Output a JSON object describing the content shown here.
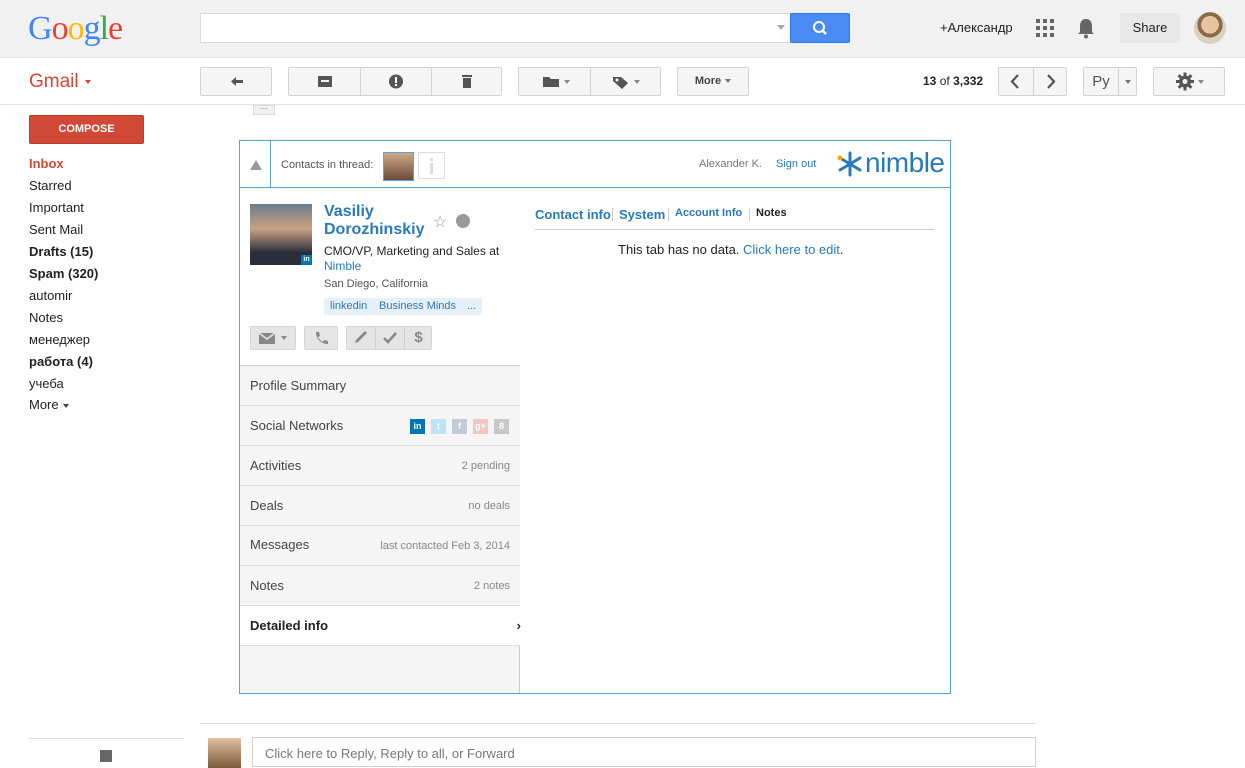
{
  "google": {
    "logo": [
      "G",
      "o",
      "o",
      "g",
      "l",
      "e"
    ],
    "logo_colors": [
      "#4285f4",
      "#ea4335",
      "#fbbc05",
      "#4285f4",
      "#34a853",
      "#ea4335"
    ]
  },
  "topbar": {
    "user_name": "+Александр",
    "share_label": "Share"
  },
  "toolbar": {
    "gmail_label": "Gmail",
    "more_label": "More",
    "page_current": "13",
    "page_of": "of",
    "page_total": "3,332",
    "lang_label": "Ру"
  },
  "sidebar": {
    "compose": "COMPOSE",
    "items": [
      {
        "label": "Inbox"
      },
      {
        "label": "Starred"
      },
      {
        "label": "Important"
      },
      {
        "label": "Sent Mail"
      },
      {
        "label": "Drafts (15)"
      },
      {
        "label": "Spam (320)"
      },
      {
        "label": "automir"
      },
      {
        "label": "Notes"
      },
      {
        "label": "менеджер"
      },
      {
        "label": "работа (4)"
      },
      {
        "label": "учеба"
      },
      {
        "label": "More"
      }
    ]
  },
  "nimble": {
    "contacts_label": "Contacts in thread:",
    "user": "Alexander K.",
    "signout": "Sign out",
    "logo_text": "nimble",
    "contact": {
      "name": "Vasiliy Dorozhinskiy",
      "title": "CMO/VP, Marketing and Sales at",
      "company": "Nimble",
      "location": "San Diego, California",
      "tags": [
        "linkedin",
        "Business Minds",
        "..."
      ],
      "li_badge": "in"
    },
    "rows": [
      {
        "label": "Profile Summary",
        "value": ""
      },
      {
        "label": "Social Networks",
        "value": ""
      },
      {
        "label": "Activities",
        "value": "2 pending"
      },
      {
        "label": "Deals",
        "value": "no deals"
      },
      {
        "label": "Messages",
        "value": "last contacted Feb 3, 2014"
      },
      {
        "label": "Notes",
        "value": "2 notes"
      },
      {
        "label": "Detailed info",
        "value": "›"
      }
    ],
    "social": [
      "in",
      "t",
      "f",
      "g+",
      "8"
    ],
    "tabs": [
      "Contact info",
      "System",
      "Account Info",
      "Notes"
    ],
    "no_data": "This tab has no data.",
    "edit_link": "Click here to edit",
    "edit_suffix": "."
  },
  "reply": {
    "placeholder": "Click here to Reply, Reply to all, or Forward"
  }
}
